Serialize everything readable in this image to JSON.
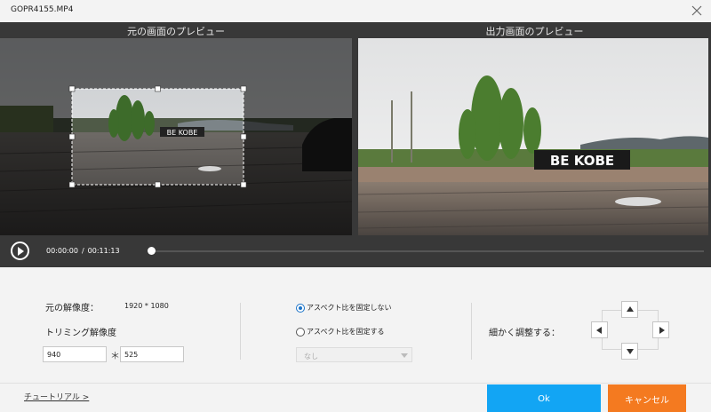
{
  "window": {
    "title": "GOPR4155.MP4",
    "close_icon": "close-icon"
  },
  "preview": {
    "original_label": "元の画面のプレビュー",
    "output_label": "出力画面のプレビュー",
    "sign_text": "BE KOBE"
  },
  "player": {
    "play_icon": "play-icon",
    "current_time": "00:00:00",
    "separator": "/",
    "total_time": "00:11:13",
    "progress": 0
  },
  "settings": {
    "original_resolution_label": "元の解像度：",
    "original_resolution_value": "1920 * 1080",
    "trim_resolution_label": "トリミング解像度",
    "width_value": "940",
    "multiply_sign": "＊",
    "height_value": "525",
    "aspect_unlocked_label": "アスペクト比を固定しない",
    "aspect_locked_label": "アスペクト比を固定する",
    "aspect_selected": "unlocked",
    "ratio_select_value": "なし",
    "fine_adjust_label": "細かく調整する："
  },
  "footer": {
    "tutorial_link": "チュートリアル >",
    "ok_label": "Ok",
    "cancel_label": "キャンセル"
  },
  "colors": {
    "ok": "#12a5f4",
    "cancel": "#f47a20",
    "radio_accent": "#1a73c8"
  }
}
